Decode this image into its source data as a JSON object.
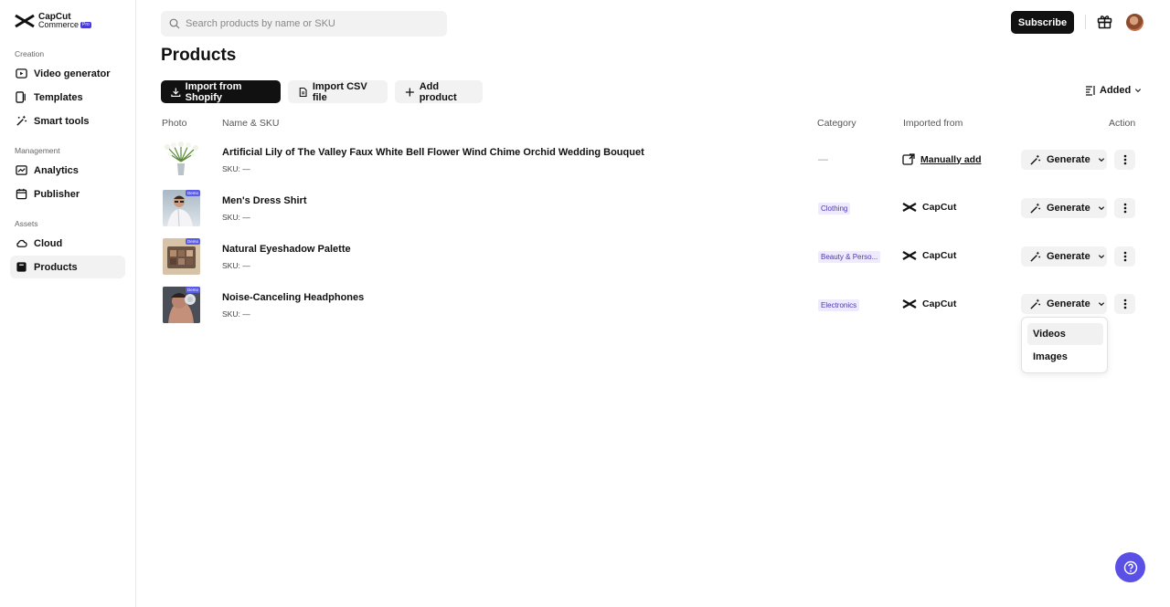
{
  "brand": {
    "line1": "CapCut",
    "line2": "Commerce",
    "badge": "Pro"
  },
  "sidebar": {
    "sections": [
      "Creation",
      "Management",
      "Assets"
    ],
    "items": [
      {
        "label": "Video generator",
        "icon": "video-icon"
      },
      {
        "label": "Templates",
        "icon": "templates-icon"
      },
      {
        "label": "Smart tools",
        "icon": "magic-wand-icon"
      },
      {
        "label": "Analytics",
        "icon": "chart-icon"
      },
      {
        "label": "Publisher",
        "icon": "calendar-icon"
      },
      {
        "label": "Cloud",
        "icon": "cloud-icon"
      },
      {
        "label": "Products",
        "icon": "products-icon"
      }
    ]
  },
  "header": {
    "search_placeholder": "Search products by name or SKU",
    "subscribe": "Subscribe"
  },
  "page": {
    "title": "Products",
    "import_shopify": "Import from Shopify",
    "import_csv": "Import CSV file",
    "add_product": "Add product",
    "sort_label": "Added"
  },
  "table": {
    "headers": [
      "Photo",
      "Name & SKU",
      "Category",
      "Imported from",
      "Action"
    ],
    "rows": [
      {
        "name": "Artificial Lily of The Valley Faux White Bell Flower Wind Chime Orchid Wedding Bouquet",
        "sku": "SKU: —",
        "category": "—",
        "imported": "Manually add",
        "demo": "",
        "generate": "Generate"
      },
      {
        "name": "Men's Dress Shirt",
        "sku": "SKU: —",
        "category": "Clothing",
        "imported": "CapCut",
        "demo": "Demo",
        "generate": "Generate"
      },
      {
        "name": "Natural Eyeshadow Palette",
        "sku": "SKU: —",
        "category": "Beauty & Perso...",
        "imported": "CapCut",
        "demo": "Demo",
        "generate": "Generate"
      },
      {
        "name": "Noise-Canceling Headphones",
        "sku": "SKU: —",
        "category": "Electronics",
        "imported": "CapCut",
        "demo": "Demo",
        "generate": "Generate"
      }
    ]
  },
  "generate_menu": {
    "items": [
      "Videos",
      "Images"
    ]
  },
  "colors": {
    "accent": "#5a50e6",
    "category_bg": "#efeafd",
    "category_text": "#4a3bb5"
  }
}
